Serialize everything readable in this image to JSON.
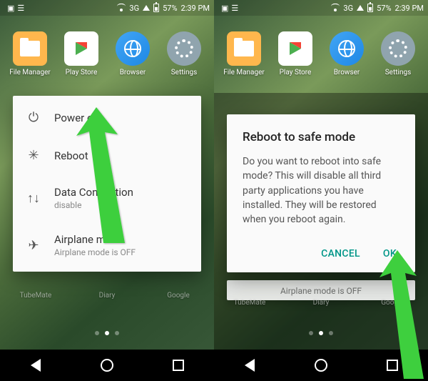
{
  "status": {
    "network": "3G",
    "battery_pct": "57%",
    "time": "2:39 PM"
  },
  "apps": [
    {
      "label": "File Manager"
    },
    {
      "label": "Play Store"
    },
    {
      "label": "Browser"
    },
    {
      "label": "Settings"
    }
  ],
  "bg_apps": [
    {
      "label": "TubeMate"
    },
    {
      "label": "Diary"
    },
    {
      "label": "Google"
    }
  ],
  "power_menu": {
    "items": [
      {
        "title": "Power off",
        "sub": ""
      },
      {
        "title": "Reboot",
        "sub": ""
      },
      {
        "title": "Data Connection",
        "sub": "disable"
      },
      {
        "title": "Airplane mode",
        "sub": "Airplane mode is OFF"
      }
    ]
  },
  "dialog": {
    "title": "Reboot to safe mode",
    "body": "Do you want to reboot into safe mode? This will disable all third party applications you have installed. They will be restored when you reboot again.",
    "cancel": "CANCEL",
    "ok": "OK"
  },
  "colors": {
    "accent": "#009688",
    "arrow": "#4cd137"
  }
}
